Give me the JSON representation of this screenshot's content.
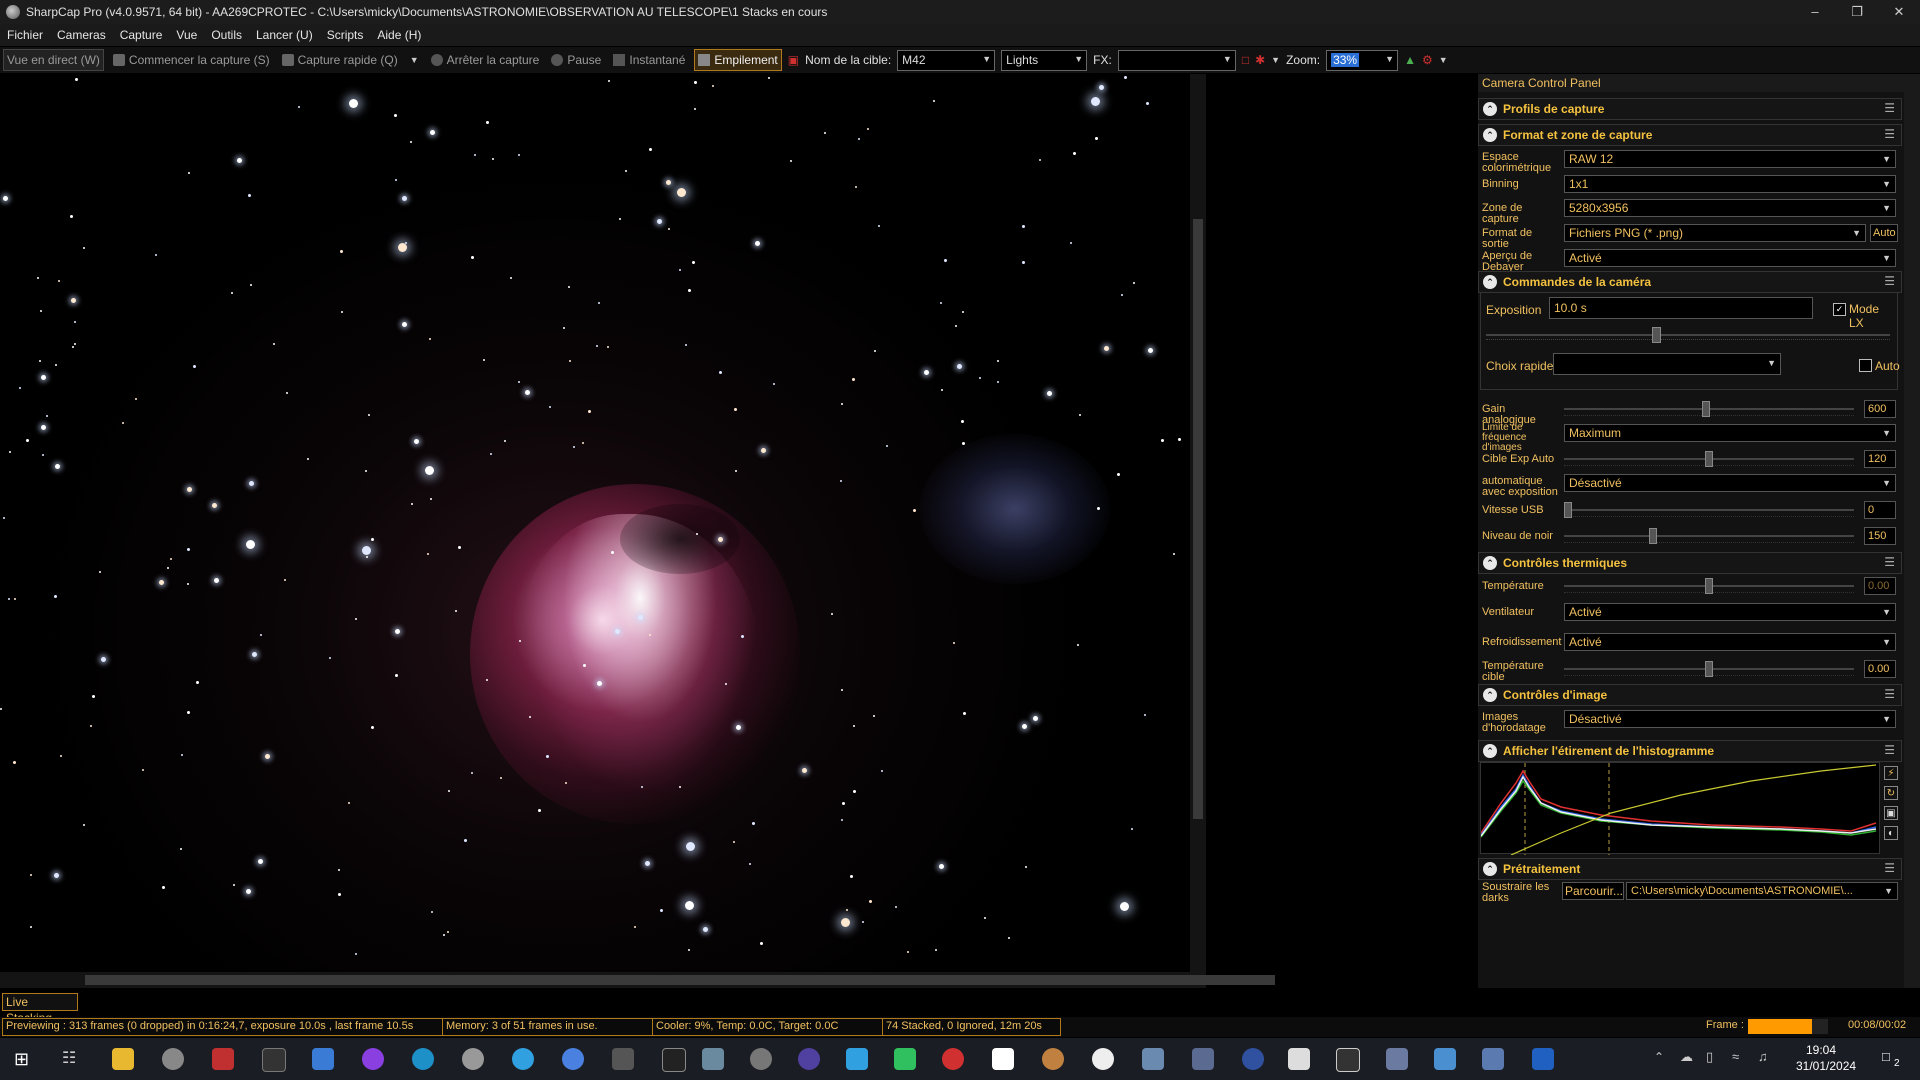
{
  "title_bar": {
    "title": "SharpCap Pro (v4.0.9571, 64 bit) - AA269CPROTEC - C:\\Users\\micky\\Documents\\ASTRONOMIE\\OBSERVATION AU TELESCOPE\\1 Stacks en cours"
  },
  "menu": [
    "Fichier",
    "Cameras",
    "Capture",
    "Vue",
    "Outils",
    "Lancer (U)",
    "Scripts",
    "Aide (H)"
  ],
  "toolbar": {
    "live_view": "Vue en direct (W)",
    "start_capture": "Commencer la capture (S)",
    "quick_capture": "Capture rapide (Q)",
    "stop_capture": "Arrêter la capture",
    "pause": "Pause",
    "snapshot": "Instantané",
    "stacking": "Empilement",
    "target_label": "Nom de la cible:",
    "target_value": "M42",
    "frame_type": "Lights",
    "fx_label": "FX:",
    "fx_value": "",
    "zoom_label": "Zoom:",
    "zoom_value": "33%"
  },
  "live_stacking_tab": "Live Stacking",
  "panel": {
    "title": "Camera Control Panel",
    "sections": {
      "profiles": "Profils de capture",
      "format": "Format et zone de capture",
      "camera": "Commandes de la caméra",
      "thermal": "Contrôles thermiques",
      "image": "Contrôles d'image",
      "histogram": "Afficher l'étirement de l'histogramme",
      "preprocess": "Prétraitement"
    },
    "format_rows": {
      "colorspace_label": "Espace colorimétrique",
      "colorspace_value": "RAW 12",
      "binning_label": "Binning",
      "binning_value": "1x1",
      "roi_label": "Zone de capture",
      "roi_value": "5280x3956",
      "output_label": "Format de sortie",
      "output_value": "Fichiers PNG (* .png)",
      "output_auto": "Auto",
      "debayer_label": "Aperçu de Debayer",
      "debayer_value": "Activé"
    },
    "camera_rows": {
      "exposure_label": "Exposition",
      "exposure_value": "10.0 s",
      "lx_label": "Mode LX",
      "lx_checked": true,
      "quick_label": "Choix rapides",
      "quick_value": "",
      "quick_auto": "Auto",
      "gain_label": "Gain analogique",
      "gain_value": "600",
      "gain_level": 0.49,
      "fps_label": "Limite de fréquence d'images",
      "fps_value": "Maximum",
      "autoexp_target_label": "Cible Exp Auto",
      "autoexp_target_value": "120",
      "autoexp_target_level": 0.5,
      "autoexp_label": "automatique avec exposition",
      "autoexp_value": "Désactivé",
      "usb_label": "Vitesse USB",
      "usb_value": "0",
      "usb_level": 0.0,
      "black_label": "Niveau de noir",
      "black_value": "150",
      "black_level": 0.3
    },
    "thermal_rows": {
      "temp_label": "Température",
      "temp_value": "0.00",
      "temp_level": 0.5,
      "fan_label": "Ventilateur",
      "fan_value": "Activé",
      "cooling_label": "Refroidissement",
      "cooling_value": "Activé",
      "target_temp_label": "Température cible",
      "target_temp_value": "0.00",
      "target_temp_level": 0.5
    },
    "image_rows": {
      "timestamp_label": "Images d'horodatage",
      "timestamp_value": "Désactivé"
    },
    "preprocess_rows": {
      "darks_label": "Soustraire les darks",
      "browse": "Parcourir...",
      "darks_path": "C:\\Users\\micky\\Documents\\ASTRONOMIE\\..."
    }
  },
  "status": {
    "previewing": "Previewing : 313 frames (0 dropped) in 0:16:24,7, exposure 10.0s , last frame 10.5s",
    "memory": "Memory: 3 of 51 frames in use.",
    "cooler": "Cooler: 9%, Temp: 0.0C, Target: 0.0C",
    "stacked": "74 Stacked, 0 Ignored, 12m 20s",
    "frame_label": "Frame :",
    "frame_time": "00:08/00:02",
    "frame_progress": 0.8
  },
  "taskbar": {
    "time": "19:04",
    "date": "31/01/2024",
    "notifications": "2"
  },
  "colors": {
    "accent": "#f0c060",
    "border_orange": "#b07a1a",
    "progress": "#ff9a00"
  }
}
